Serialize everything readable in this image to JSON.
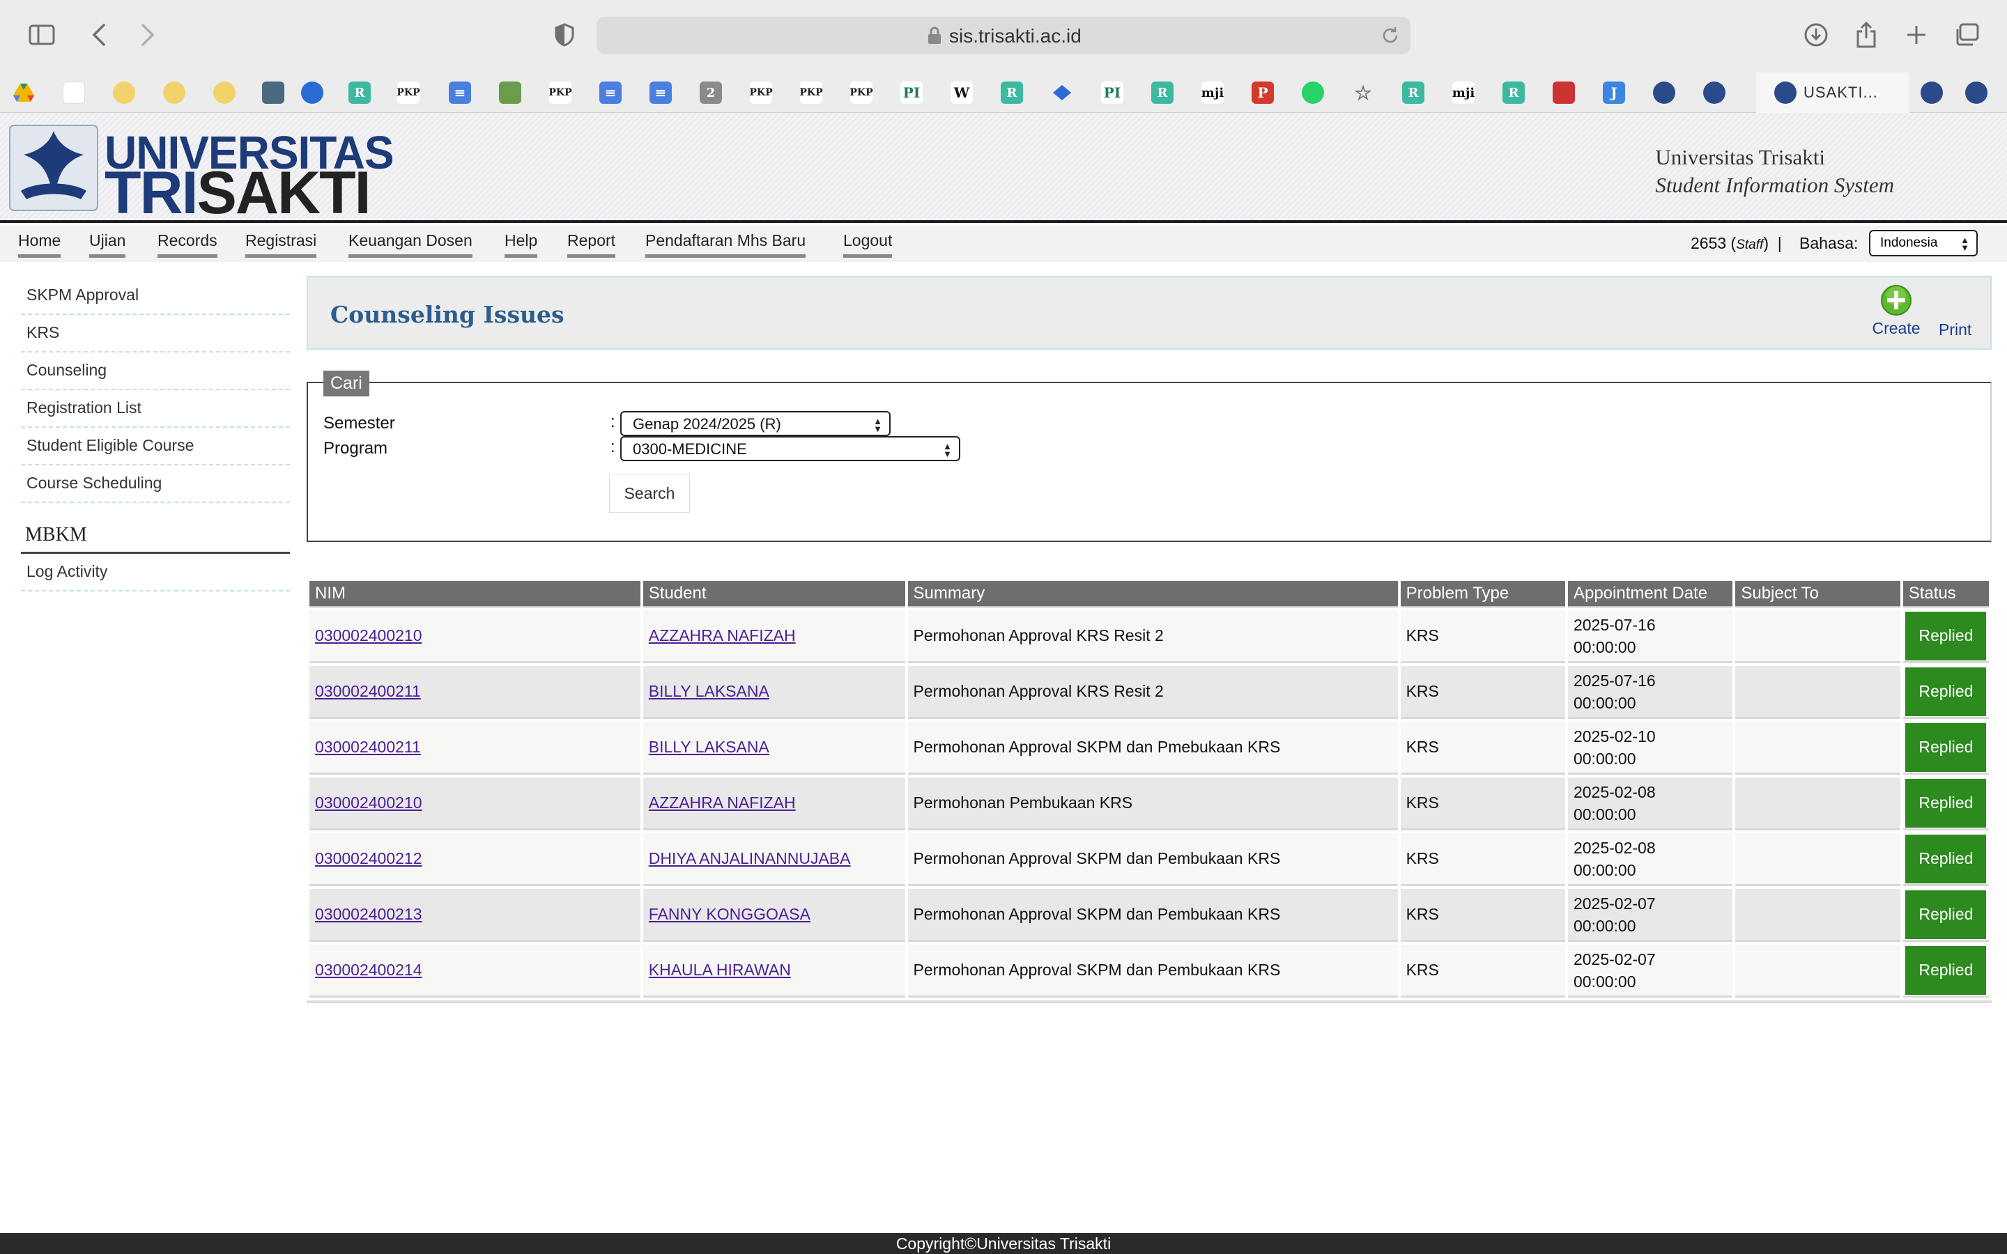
{
  "browser": {
    "url": "sis.trisakti.ac.id",
    "active_tab": "USAKTI..."
  },
  "header": {
    "logo_word1": "UNIVERSITAS",
    "logo_word2_a": "TRI",
    "logo_word2_b": "SAKTI",
    "title_line1": "Universitas Trisakti",
    "title_line2": "Student Information System"
  },
  "nav": {
    "items": [
      "Home",
      "Ujian",
      "Records",
      "Registrasi",
      "Keuangan Dosen",
      "Help",
      "Report",
      "Pendaftaran Mhs Baru",
      "Logout"
    ],
    "user_id": "2653",
    "user_role": "Staff",
    "lang_label": "Bahasa:",
    "lang_value": "Indonesia"
  },
  "sidebar": {
    "items": [
      "SKPM Approval",
      "KRS",
      "Counseling",
      "Registration List",
      "Student Eligible Course",
      "Course Scheduling"
    ],
    "section_heading": "MBKM",
    "section_items": [
      "Log Activity"
    ]
  },
  "page": {
    "title": "Counseling Issues",
    "create_label": "Create",
    "print_label": "Print"
  },
  "search": {
    "legend": "Cari",
    "semester_label": "Semester",
    "semester_value": "Genap 2024/2025 (R)",
    "program_label": "Program",
    "program_value": "0300-MEDICINE",
    "colon": ":",
    "button_label": "Search"
  },
  "table": {
    "columns": [
      "NIM",
      "Student",
      "Summary",
      "Problem Type",
      "Appointment Date",
      "Subject To",
      "Status"
    ],
    "rows": [
      {
        "nim": "030002400210",
        "student": "AZZAHRA NAFIZAH",
        "summary": "Permohonan Approval KRS Resit 2",
        "type": "KRS",
        "date": "2025-07-16",
        "time": "00:00:00",
        "subject": "",
        "status": "Replied"
      },
      {
        "nim": "030002400211",
        "student": "BILLY LAKSANA",
        "summary": "Permohonan Approval KRS Resit 2",
        "type": "KRS",
        "date": "2025-07-16",
        "time": "00:00:00",
        "subject": "",
        "status": "Replied"
      },
      {
        "nim": "030002400211",
        "student": "BILLY LAKSANA",
        "summary": "Permohonan Approval SKPM dan Pmebukaan KRS",
        "type": "KRS",
        "date": "2025-02-10",
        "time": "00:00:00",
        "subject": "",
        "status": "Replied"
      },
      {
        "nim": "030002400210",
        "student": "AZZAHRA NAFIZAH",
        "summary": "Permohonan Pembukaan KRS",
        "type": "KRS",
        "date": "2025-02-08",
        "time": "00:00:00",
        "subject": "",
        "status": "Replied"
      },
      {
        "nim": "030002400212",
        "student": "DHIYA ANJALINANNUJABA",
        "summary": "Permohonan Approval SKPM dan Pembukaan KRS",
        "type": "KRS",
        "date": "2025-02-08",
        "time": "00:00:00",
        "subject": "",
        "status": "Replied"
      },
      {
        "nim": "030002400213",
        "student": "FANNY KONGGOASA",
        "summary": "Permohonan Approval SKPM dan Pembukaan KRS",
        "type": "KRS",
        "date": "2025-02-07",
        "time": "00:00:00",
        "subject": "",
        "status": "Replied"
      },
      {
        "nim": "030002400214",
        "student": "KHAULA HIRAWAN",
        "summary": "Permohonan Approval SKPM dan Pembukaan KRS",
        "type": "KRS",
        "date": "2025-02-07",
        "time": "00:00:00",
        "subject": "",
        "status": "Replied"
      }
    ]
  },
  "footer": {
    "text": "Copyright©Universitas Trisakti"
  },
  "colors": {
    "status_replied": "#2c8a1f",
    "header_blue": "#1d3b78",
    "title_blue": "#2b5d8e",
    "link_purple": "#4b1f96"
  }
}
